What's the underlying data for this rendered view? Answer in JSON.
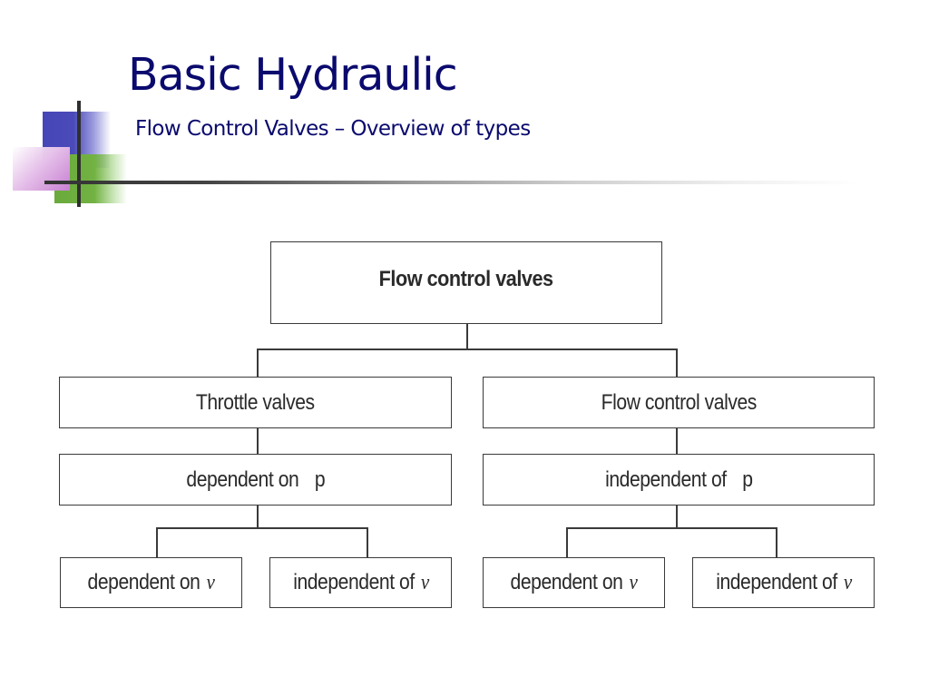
{
  "header": {
    "title": "Basic Hydraulic",
    "subtitle": "Flow Control Valves – Overview of types"
  },
  "diagram": {
    "root": {
      "label": "Flow control valves"
    },
    "branches": [
      {
        "label": "Throttle valves",
        "condition": {
          "text": "dependent on",
          "symbol": "p"
        },
        "leaves": [
          {
            "text": "dependent on",
            "symbol": "ν"
          },
          {
            "text": "independent of",
            "symbol": "ν"
          }
        ]
      },
      {
        "label": "Flow control valves",
        "condition": {
          "text": "independent of",
          "symbol": "p"
        },
        "leaves": [
          {
            "text": "dependent on",
            "symbol": "ν"
          },
          {
            "text": "independent of",
            "symbol": "ν"
          }
        ]
      }
    ]
  },
  "colors": {
    "title": "#0a0a6e",
    "deco_blue": "#4646b8",
    "deco_green": "#72b243",
    "deco_pink": "#c77fd1"
  }
}
